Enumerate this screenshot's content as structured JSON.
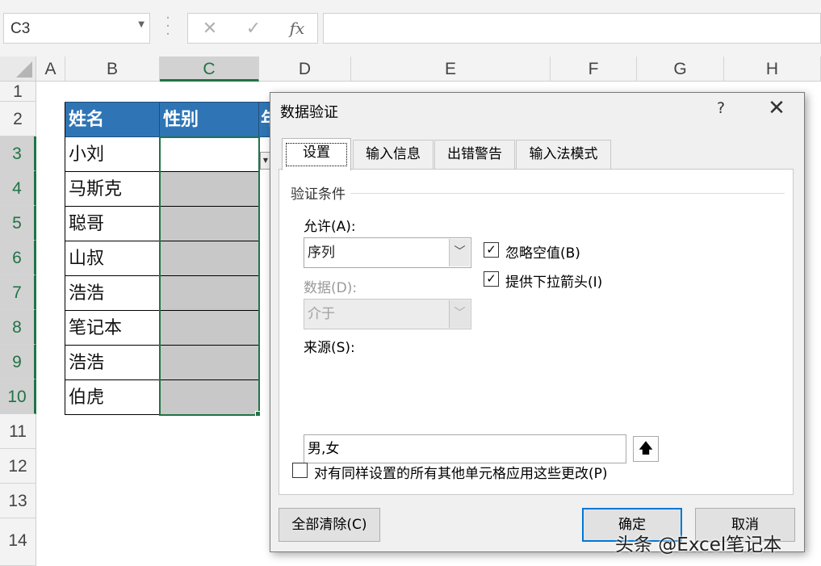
{
  "formula_bar": {
    "name_box": "C3",
    "cancel_icon": "✕",
    "enter_icon": "✓",
    "function_icon": "fx",
    "formula": ""
  },
  "columns": [
    "A",
    "B",
    "C",
    "D",
    "E",
    "F",
    "G",
    "H"
  ],
  "rows": [
    "1",
    "2",
    "3",
    "4",
    "5",
    "6",
    "7",
    "8",
    "9",
    "10",
    "11",
    "12",
    "13",
    "14"
  ],
  "table": {
    "headers": [
      "姓名",
      "性别",
      "年"
    ],
    "names": [
      "小刘",
      "马斯克",
      "聪哥",
      "山叔",
      "浩浩",
      "笔记本",
      "浩浩",
      "伯虎"
    ]
  },
  "dialog": {
    "title": "数据验证",
    "help": "?",
    "close": "✕",
    "tabs": [
      "设置",
      "输入信息",
      "出错警告",
      "输入法模式"
    ],
    "group_label": "验证条件",
    "allow_label": "允许(A):",
    "allow_value": "序列",
    "data_label": "数据(D):",
    "data_value": "介于",
    "ignore_blank": {
      "label": "忽略空值(B)",
      "checked": true
    },
    "in_cell_dropdown": {
      "label": "提供下拉箭头(I)",
      "checked": true
    },
    "source_label": "来源(S):",
    "source_value": "男,女",
    "apply_all": {
      "label": "对有同样设置的所有其他单元格应用这些更改(P)",
      "checked": false
    },
    "clear_all_button": "全部清除(C)",
    "ok_button": "确定",
    "cancel_button": "取消"
  },
  "watermark": "头条 @Excel笔记本",
  "colors": {
    "header_fill": "#2f75b5",
    "selection": "#217346",
    "gray_fill": "#c8c8c8",
    "default_button_border": "#0078d7"
  }
}
